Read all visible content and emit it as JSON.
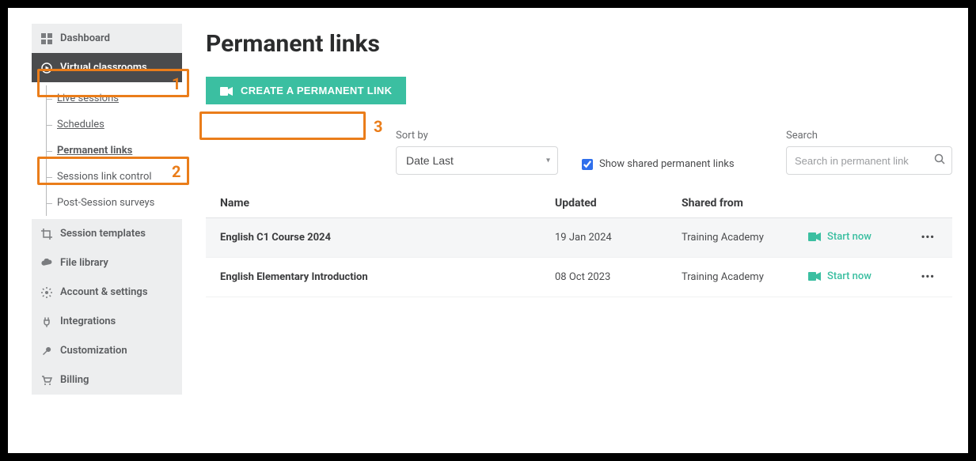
{
  "sidebar": {
    "dashboard": "Dashboard",
    "virtual_classrooms": "Virtual classrooms",
    "sub": {
      "live_sessions": "Live sessions",
      "schedules": "Schedules",
      "permanent_links": "Permanent links",
      "sessions_link_control": "Sessions link control",
      "post_session_surveys": "Post-Session surveys"
    },
    "session_templates": "Session templates",
    "file_library": "File library",
    "account_settings": "Account & settings",
    "integrations": "Integrations",
    "customization": "Customization",
    "billing": "Billing"
  },
  "header": {
    "title": "Permanent links",
    "create_button": "CREATE A PERMANENT LINK"
  },
  "controls": {
    "sort_label": "Sort by",
    "sort_value": "Date Last",
    "show_shared_label": "Show shared permanent links",
    "show_shared_checked": true,
    "search_label": "Search",
    "search_placeholder": "Search in permanent link"
  },
  "table": {
    "columns": {
      "name": "Name",
      "updated": "Updated",
      "shared_from": "Shared from"
    },
    "rows": [
      {
        "name": "English C1 Course 2024",
        "updated": "19 Jan 2024",
        "shared_from": "Training Academy",
        "action": "Start now"
      },
      {
        "name": "English Elementary Introduction",
        "updated": "08 Oct 2023",
        "shared_from": "Training Academy",
        "action": "Start now"
      }
    ]
  },
  "annotations": {
    "one": "1",
    "two": "2",
    "three": "3"
  }
}
